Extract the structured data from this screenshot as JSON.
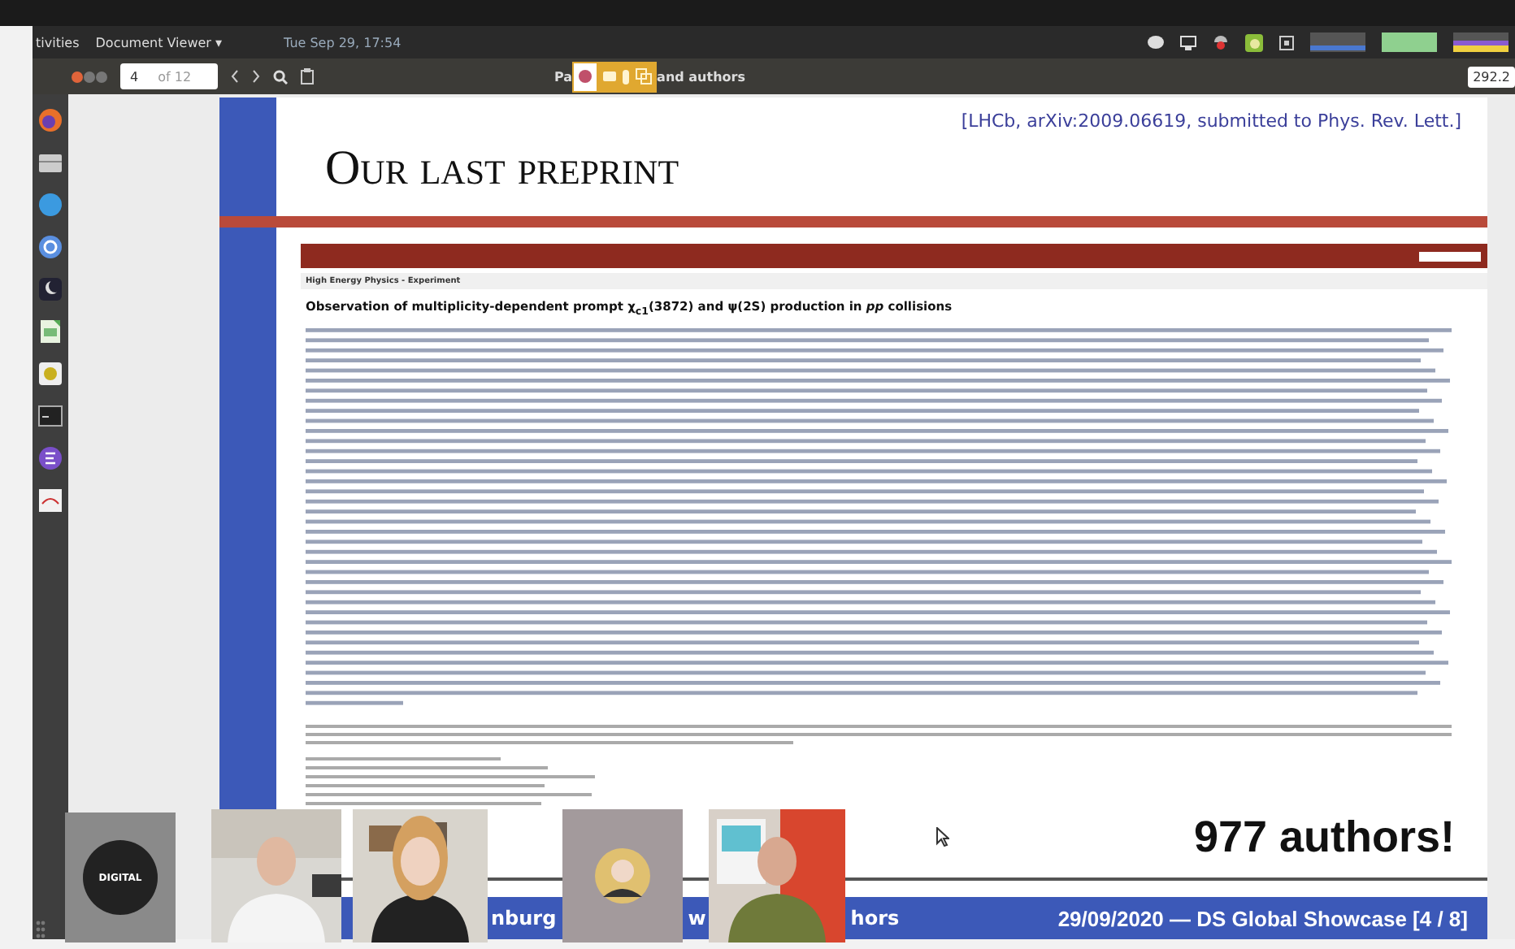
{
  "top_bar": {
    "activities": "tivities",
    "app_menu": "Document Viewer ▾",
    "clock": "Tue Sep 29, 17:54"
  },
  "toolbar": {
    "page_value": "4",
    "page_total": "of 12",
    "title_start": "Pa",
    "title_end": "and authors",
    "side_value": "292.2"
  },
  "slide": {
    "citation": "[LHCb, arXiv:2009.06619, submitted to Phys. Rev. Lett.]",
    "title": "Our last preprint",
    "embedded": {
      "section": "High Energy Physics - Experiment",
      "paper_title": "Observation of multiplicity-dependent prompt χ$_{c1}$(3872) and ψ(2S) production in *pp* collisions"
    },
    "callout": "977 authors!",
    "footer_left": [
      "nburg",
      "w",
      "hors"
    ],
    "footer_right": "29/09/2020 — DS Global Showcase [4 / 8]"
  },
  "participants": [
    {
      "kind": "logo",
      "label": "DIGITAL"
    },
    {
      "kind": "video"
    },
    {
      "kind": "video"
    },
    {
      "kind": "avatar"
    },
    {
      "kind": "video"
    }
  ]
}
